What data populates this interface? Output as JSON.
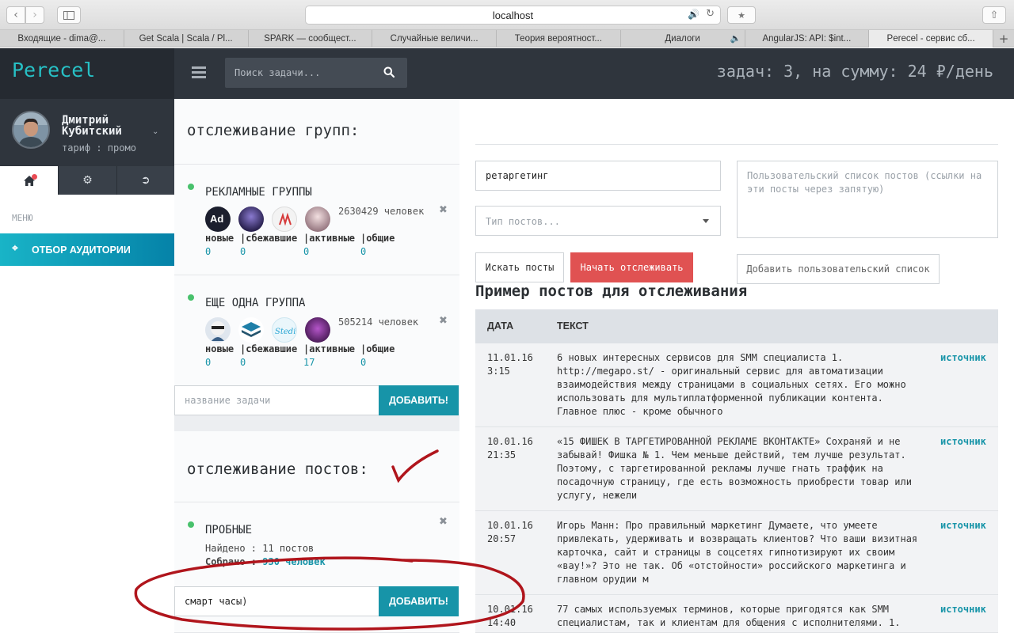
{
  "browser": {
    "url": "localhost",
    "tabs": [
      {
        "label": "Входящие - dima@..."
      },
      {
        "label": "Get Scala | Scala / Pl..."
      },
      {
        "label": "SPARK — сообщест..."
      },
      {
        "label": "Случайные величи..."
      },
      {
        "label": "Теория вероятност..."
      },
      {
        "label": "Диалоги"
      },
      {
        "label": "AngularJS: API: $int..."
      },
      {
        "label": "Perecel - сервис сб..."
      }
    ],
    "new_tab": "+"
  },
  "header": {
    "logo": "Perecel",
    "search_placeholder": "Поиск задачи...",
    "summary": "задач: 3, на сумму: 24 ₽/день"
  },
  "profile": {
    "name": "Дмитрий Кубитский",
    "plan": "тариф : промо"
  },
  "sidebar": {
    "menu_label": "МЕНЮ",
    "active_item": "ОТБОР АУДИТОРИИ"
  },
  "groups_section": {
    "title": "отслеживание групп:",
    "stat_labels": [
      "новые",
      "|сбежавшие",
      "|активные",
      "|общие"
    ],
    "groups": [
      {
        "name": "РЕКЛАМНЫЕ ГРУППЫ",
        "count": "2630429 человек",
        "stats": [
          "0",
          "0",
          "0",
          "0"
        ]
      },
      {
        "name": "ЕЩЕ ОДНА ГРУППА",
        "count": "505214 человек",
        "stats": [
          "0",
          "0",
          "17",
          "0"
        ]
      }
    ],
    "input_placeholder": "название задачи",
    "add_button": "ДОБАВИТЬ!"
  },
  "posts_section": {
    "title": "отслеживание постов:",
    "item": {
      "name": "ПРОБНЫЕ",
      "found_label": "Найдено : ",
      "found_value": "11 постов",
      "collected_label": "Собрано : ",
      "collected_value": "930 человек"
    },
    "input_value": "смарт часы)",
    "add_button": "ДОБАВИТЬ!"
  },
  "right": {
    "tag_value": "ретаргетинг",
    "type_placeholder": "Тип постов...",
    "list_placeholder": "Пользовательский список постов (ссылки на эти посты через запятую)",
    "search_button": "Искать посты",
    "start_button": "Начать отслеживать",
    "add_list_button": "Добавить пользовательский список",
    "example_title": "Пример постов для отслеживания",
    "table": {
      "col_date": "ДАТА",
      "col_text": "ТЕКСТ",
      "source_label": "источник",
      "rows": [
        {
          "date": "11.01.16\n3:15",
          "text": "6 новых интересных сервисов для SMM специалиста 1. http://megapo.st/ - оригинальный сервис для автоматизации взаимодействия между страницами в социальных сетях. Его можно использовать для мультиплатформенной публикации контента. Главное плюс - кроме обычного"
        },
        {
          "date": "10.01.16\n21:35",
          "text": "«15 ФИШЕК В ТАРГЕТИРОВАННОЙ РЕКЛАМЕ ВКОНТАКТЕ» Сохраняй и не забывай! Фишка № 1. Чем меньше действий, тем лучше результат. Поэтому, с таргетированной рекламы лучше гнать траффик на посадочную страницу, где есть возможность приобрести товар или услугу, нежели"
        },
        {
          "date": "10.01.16\n20:57",
          "text": "Игорь Манн: Про правильный маркетинг Думаете, что умеете привлекать, удерживать и возвращать клиентов? Что ваши визитная карточка, сайт и страницы в соцсетях гипнотизируют их своим «вау!»? Это не так. Об «отстойности» российского маркетинга и главном орудии м"
        },
        {
          "date": "10.01.16\n14:40",
          "text": "77 самых используемых терминов, которые пригодятся как SMM специалистам, так и клиентам для общения с исполнителями. 1."
        }
      ]
    }
  },
  "colors": {
    "accent": "#1794a8",
    "logo": "#27c0c5",
    "danger": "#e05252",
    "header_bg": "#2f353d",
    "status_green": "#48c16c",
    "annotation_red": "#b0151c"
  }
}
